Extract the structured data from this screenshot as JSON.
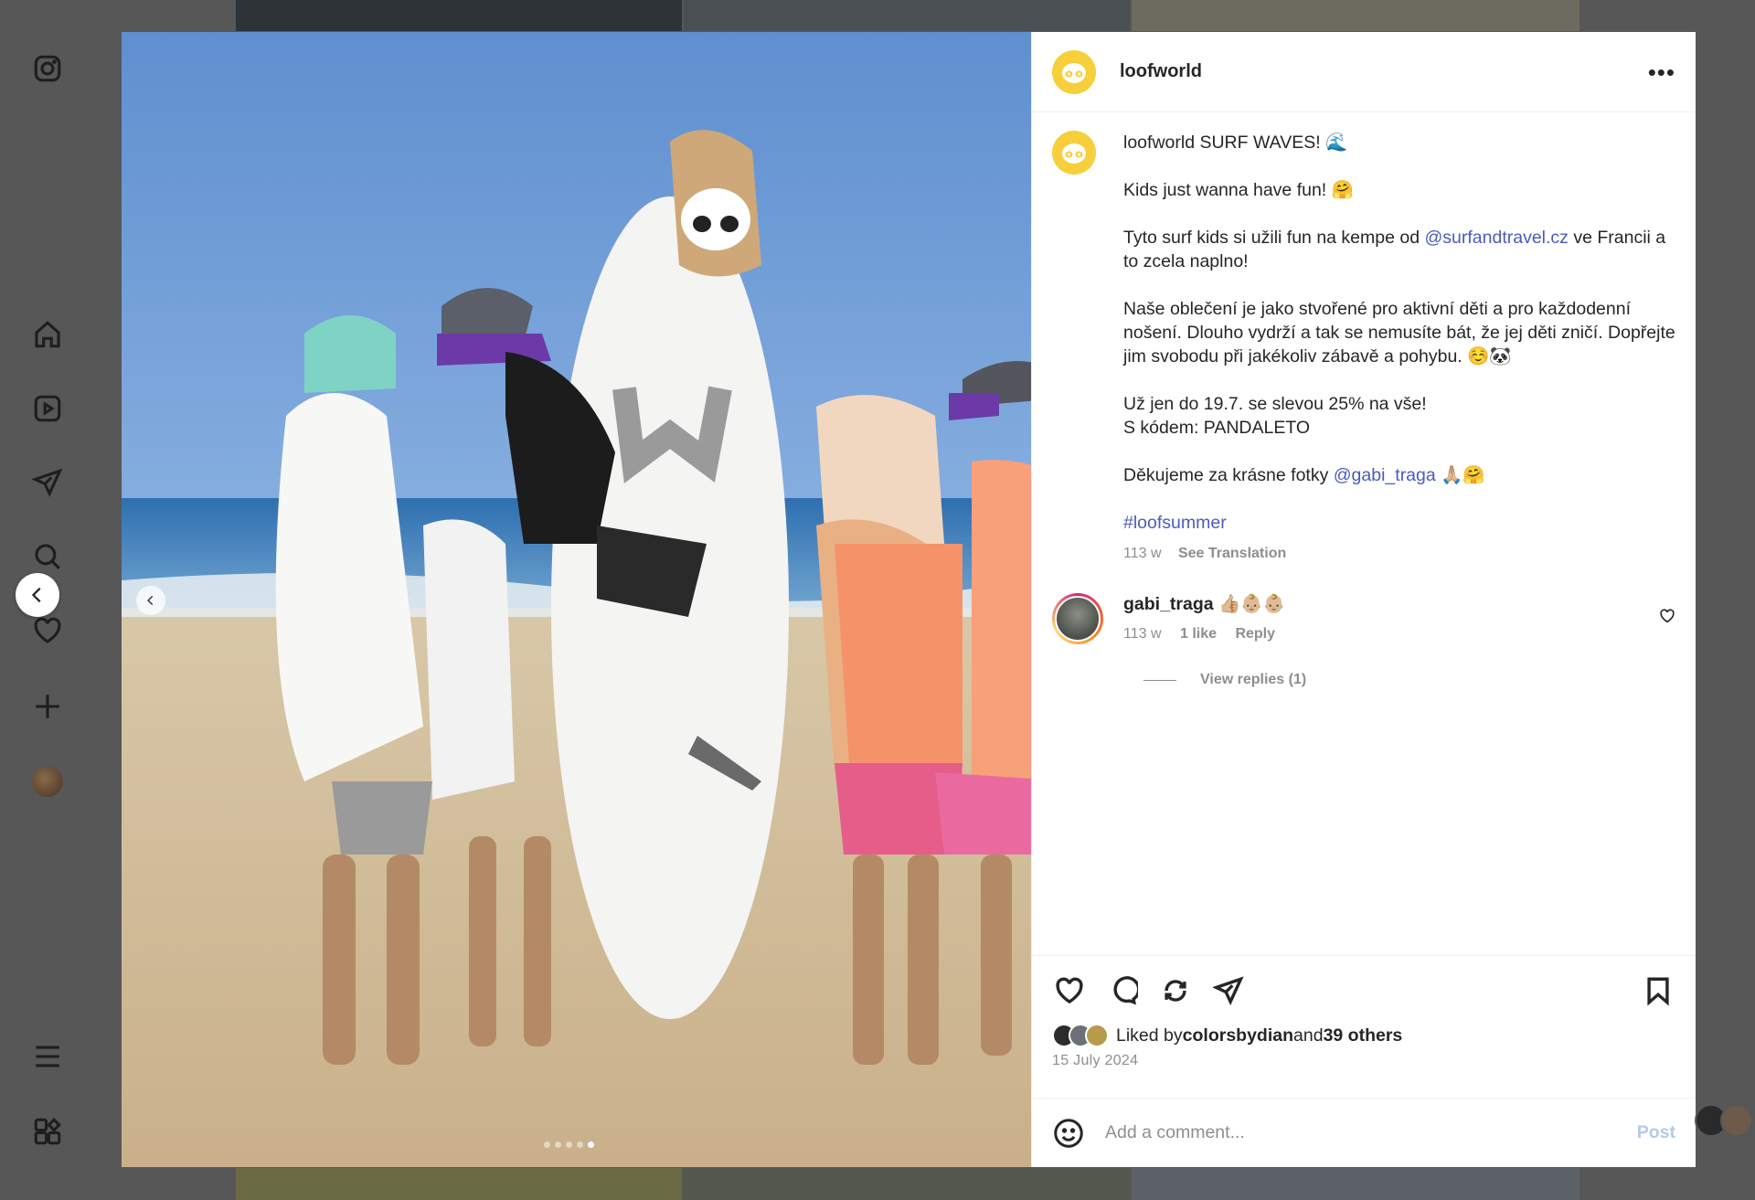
{
  "sidebar": {
    "items": [
      {
        "icon": "instagram-logo-icon"
      },
      {
        "icon": "home-icon"
      },
      {
        "icon": "reels-icon"
      },
      {
        "icon": "messages-icon"
      },
      {
        "icon": "search-icon"
      },
      {
        "icon": "notifications-heart-icon"
      },
      {
        "icon": "create-plus-icon"
      },
      {
        "icon": "profile-avatar"
      },
      {
        "icon": "menu-icon"
      },
      {
        "icon": "more-apps-icon"
      }
    ]
  },
  "post": {
    "username": "loofworld",
    "more_label": "•••",
    "carousel": {
      "count": 5,
      "active_index": 4
    },
    "caption": {
      "username": "loofworld",
      "line1": "SURF WAVES! 🌊",
      "line2": "Kids just wanna have fun! 🤗",
      "line3_pre": "Tyto surf kids si užili fun na kempe od ",
      "line3_link": "@surfandtravel.cz",
      "line3_post": " ve Francii a to zcela naplno!",
      "line4": "Naše oblečení je jako stvořené pro aktivní děti a pro každodenní nošení. Dlouho vydrží a tak se nemusíte bát, že jej děti zničí. Dopřejte jim svobodu při jakékoliv zábavě a pohybu. ☺️🐼",
      "line5": "Už jen do 19.7. se slevou 25% na vše!\nS kódem: PANDALETO",
      "line6_pre": "Děkujeme za krásne fotky ",
      "line6_link": "@gabi_traga",
      "line6_post": " 🙏🏼🤗",
      "hashtag": "#loofsummer",
      "age": "113 w",
      "see_translation": "See Translation"
    },
    "comments": [
      {
        "username": "gabi_traga",
        "text": " 👍🏼👶🏼👶🏼",
        "age": "113 w",
        "likes": "1 like",
        "reply": "Reply",
        "view_replies": "View replies (1)"
      }
    ],
    "liked_by": {
      "prefix": "Liked by ",
      "user": "colorsbydian",
      "mid": " and ",
      "others": "39 others"
    },
    "date": "15 July 2024",
    "add_comment": {
      "placeholder": "Add a comment...",
      "post_label": "Post"
    }
  }
}
